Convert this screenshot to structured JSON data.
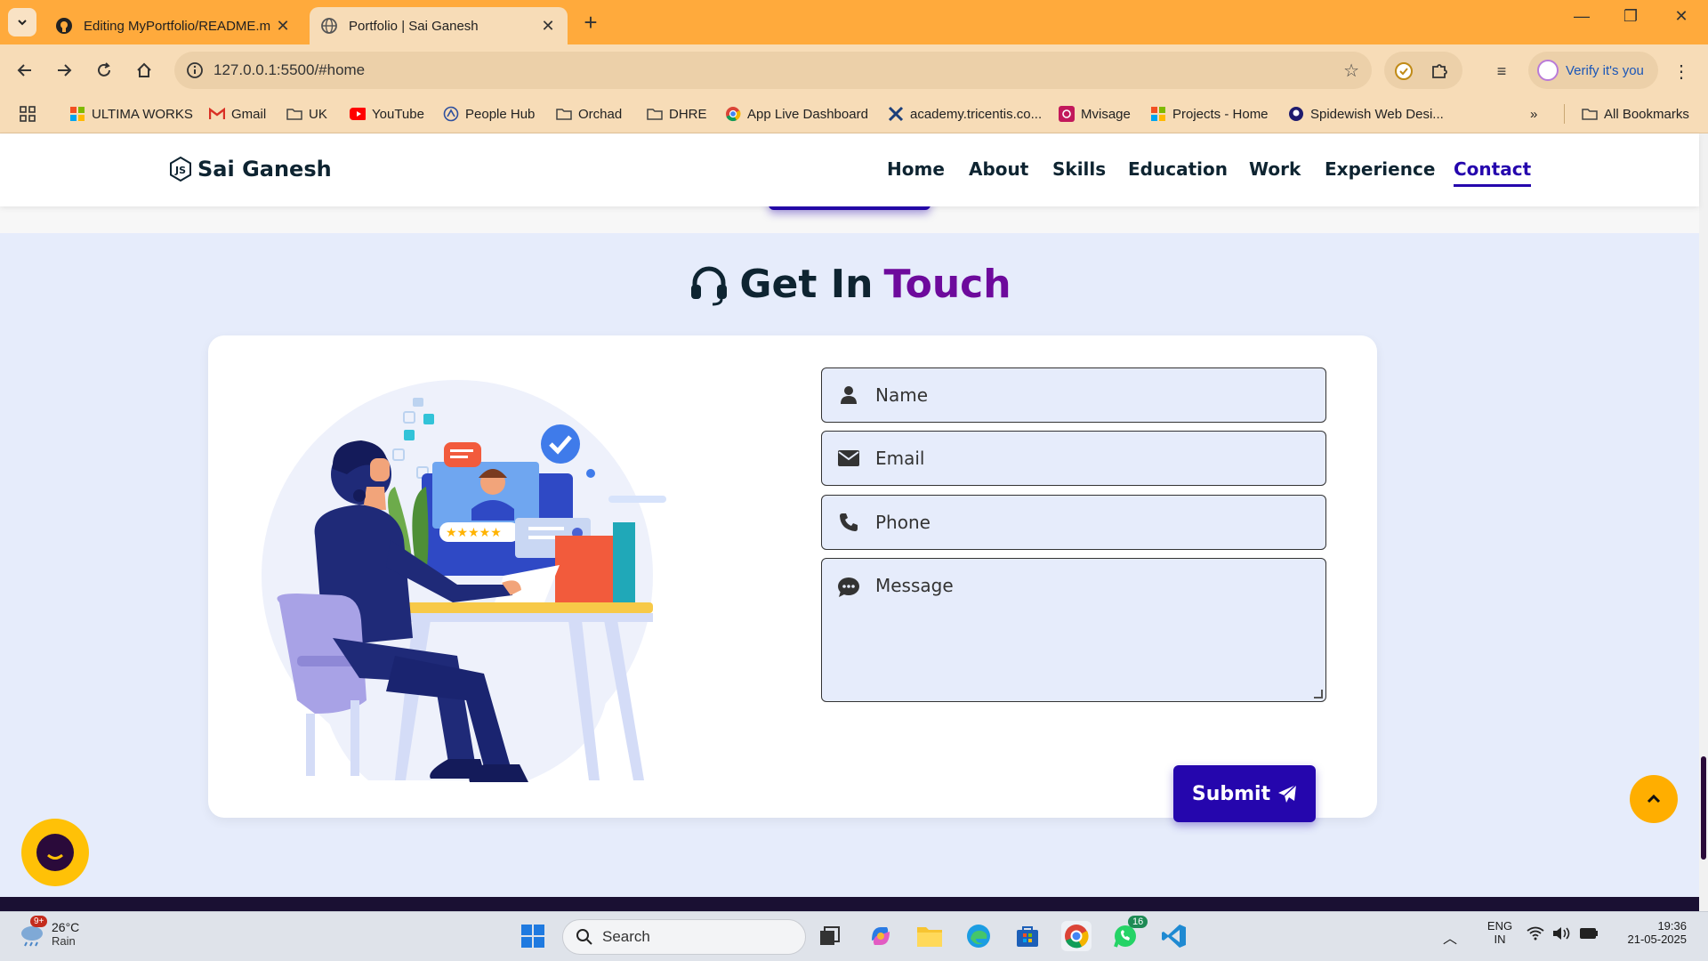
{
  "browser": {
    "tabs": [
      {
        "title": "Editing MyPortfolio/README.m",
        "icon": "github-icon",
        "active": false
      },
      {
        "title": "Portfolio | Sai Ganesh",
        "icon": "globe-icon",
        "active": true
      }
    ],
    "url": "127.0.0.1:5500/#home",
    "verify_label": "Verify it's you",
    "bookmarks": [
      "ULTIMA WORKS",
      "Gmail",
      "UK",
      "YouTube",
      "People Hub",
      "Orchad",
      "DHRE",
      "App Live Dashboard",
      "academy.tricentis.co...",
      "Mvisage",
      "Projects - Home",
      "Spidewish Web Desi..."
    ],
    "all_bookmarks": "All Bookmarks"
  },
  "site": {
    "brand": "Sai Ganesh",
    "nav": [
      "Home",
      "About",
      "Skills",
      "Education",
      "Work",
      "Experience",
      "Contact"
    ],
    "active_nav": "Contact"
  },
  "contact": {
    "title_main": "Get In",
    "title_accent": "Touch",
    "fields": {
      "name": "Name",
      "email": "Email",
      "phone": "Phone",
      "message": "Message"
    },
    "submit_label": "Submit"
  },
  "taskbar": {
    "weather_temp": "26°C",
    "weather_desc": "Rain",
    "weather_badge": "9+",
    "search_label": "Search",
    "whatsapp_badge": "16",
    "lang_line1": "ENG",
    "lang_line2": "IN",
    "time": "19:36",
    "date": "21-05-2025"
  },
  "colors": {
    "accent": "#2506ad",
    "accent_purple": "#6d0a9c",
    "tab_bar": "#ffaa3c",
    "chat_bubble": "#ffc107",
    "scroll_top": "#ffae00"
  }
}
